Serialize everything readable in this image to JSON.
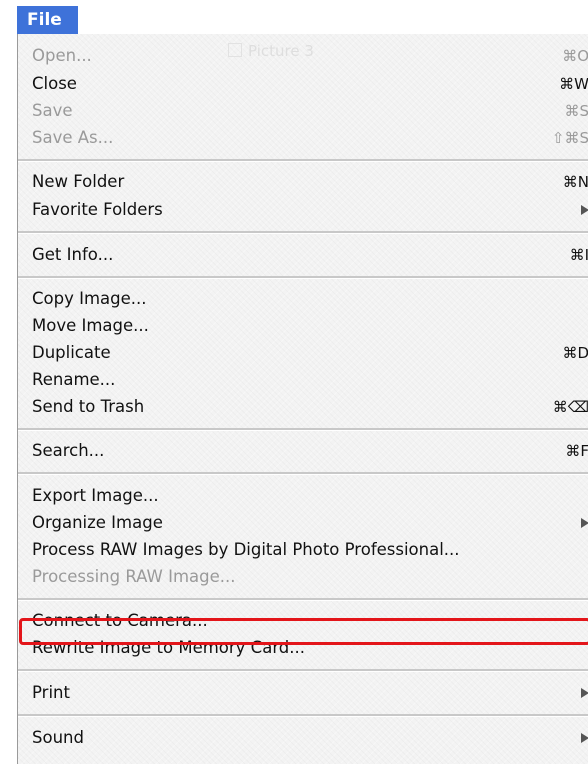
{
  "menu": {
    "title": "File",
    "ghost_window_title": "Picture 3",
    "items": [
      {
        "label": "Open...",
        "shortcut": "⌘O",
        "disabled": true
      },
      {
        "label": "Close",
        "shortcut": "⌘W",
        "disabled": false
      },
      {
        "label": "Save",
        "shortcut": "⌘S",
        "disabled": true
      },
      {
        "label": "Save As...",
        "shortcut": "⇧⌘S",
        "disabled": true
      },
      {
        "label": "New Folder",
        "shortcut": "⌘N",
        "disabled": false
      },
      {
        "label": "Favorite Folders",
        "shortcut": "",
        "disabled": false,
        "submenu": true
      },
      {
        "label": "Get Info...",
        "shortcut": "⌘I",
        "disabled": false
      },
      {
        "label": "Copy Image...",
        "shortcut": "",
        "disabled": false
      },
      {
        "label": "Move Image...",
        "shortcut": "",
        "disabled": false
      },
      {
        "label": "Duplicate",
        "shortcut": "⌘D",
        "disabled": false
      },
      {
        "label": "Rename...",
        "shortcut": "",
        "disabled": false
      },
      {
        "label": "Send to Trash",
        "shortcut": "⌘⌫",
        "disabled": false
      },
      {
        "label": "Search...",
        "shortcut": "⌘F",
        "disabled": false
      },
      {
        "label": "Export Image...",
        "shortcut": "",
        "disabled": false
      },
      {
        "label": "Organize Image",
        "shortcut": "",
        "disabled": false,
        "submenu": true
      },
      {
        "label": "Process RAW Images by Digital Photo Professional...",
        "shortcut": "",
        "disabled": false
      },
      {
        "label": "Processing RAW Image...",
        "shortcut": "",
        "disabled": true
      },
      {
        "label": "Connect to Camera...",
        "shortcut": "",
        "disabled": false
      },
      {
        "label": "Rewrite Image to Memory Card...",
        "shortcut": "",
        "disabled": false,
        "highlighted": true
      },
      {
        "label": "Print",
        "shortcut": "",
        "disabled": false,
        "submenu": true
      },
      {
        "label": "Sound",
        "shortcut": "",
        "disabled": false,
        "submenu": true
      }
    ]
  },
  "colors": {
    "menu_title_bg": "#3e72d9",
    "highlight_box": "#e3151a",
    "disabled_text": "#9a9a9a"
  }
}
